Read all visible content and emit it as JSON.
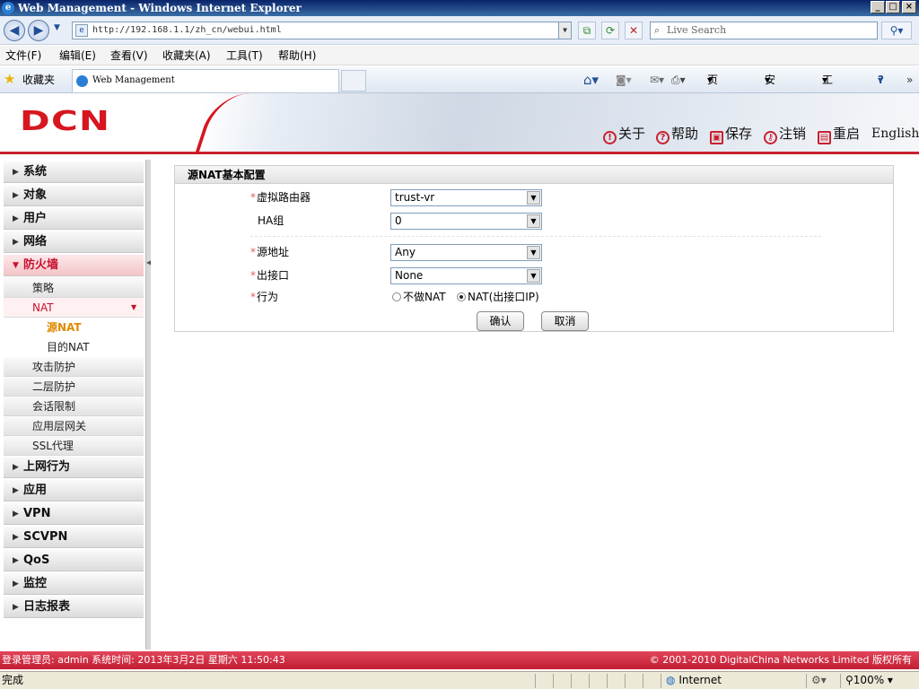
{
  "window": {
    "title": "Web Management - Windows Internet Explorer"
  },
  "address": {
    "url": "http://192.168.1.1/zh_cn/webui.html",
    "search_placeholder": "Live Search"
  },
  "menu": [
    "文件(F)",
    "编辑(E)",
    "查看(V)",
    "收藏夹(A)",
    "工具(T)",
    "帮助(H)"
  ],
  "favbar": {
    "favorites": "收藏夹",
    "tab_title": "Web Management"
  },
  "cmdbar": {
    "page": "页面(P)",
    "safety": "安全(S)",
    "tools": "工具(O)",
    "help": "?"
  },
  "header": {
    "logo": "DCN",
    "links": {
      "about": "关于",
      "help": "帮助",
      "save": "保存",
      "logout": "注销",
      "reboot": "重启",
      "language": "English"
    }
  },
  "sidebar": {
    "items": [
      "系统",
      "对象",
      "用户",
      "网络",
      "防火墙"
    ],
    "firewall_subitems": [
      "策略",
      "NAT"
    ],
    "nat_subitems": [
      "源NAT",
      "目的NAT"
    ],
    "more_subitems": [
      "攻击防护",
      "二层防护",
      "会话限制",
      "应用层网关",
      "SSL代理"
    ],
    "bottom_items": [
      "上网行为",
      "应用",
      "VPN",
      "SCVPN",
      "QoS",
      "监控",
      "日志报表"
    ]
  },
  "form": {
    "title": "源NAT基本配置",
    "vr_label": "虚拟路由器",
    "vr_value": "trust-vr",
    "ha_label": "HA组",
    "ha_value": "0",
    "src_label": "源地址",
    "src_value": "Any",
    "egress_label": "出接口",
    "egress_value": "None",
    "action_label": "行为",
    "action_opt1": "不做NAT",
    "action_opt2": "NAT(出接口IP)",
    "selected_action": "NAT(出接口IP)",
    "required_mark": "*",
    "ok": "确认",
    "cancel": "取消"
  },
  "footer": {
    "left": "登录管理员: admin 系统时间: 2013年3月2日 星期六 11:50:43",
    "right": "© 2001-2010 DigitalChina Networks Limited 版权所有"
  },
  "status": {
    "text": "完成",
    "zone": "Internet",
    "zoom": "100%"
  }
}
